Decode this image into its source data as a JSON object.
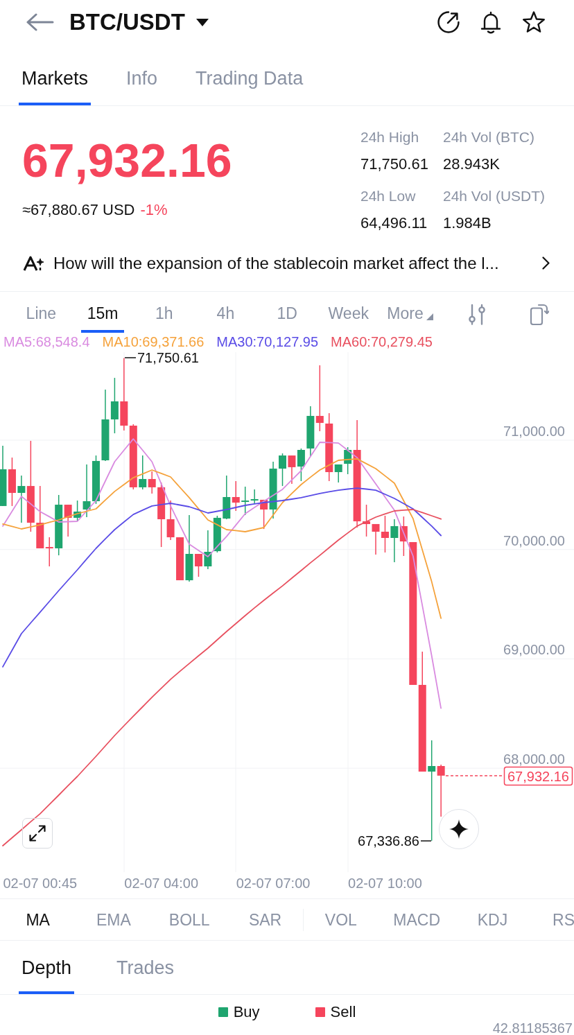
{
  "header": {
    "title": "BTC/USDT"
  },
  "tabs": [
    {
      "label": "Markets",
      "selected": true
    },
    {
      "label": "Info",
      "selected": false
    },
    {
      "label": "Trading Data",
      "selected": false
    }
  ],
  "ticker": {
    "price": "67,932.16",
    "fiat_value": "≈67,880.67 USD",
    "change": "-1%",
    "stats": [
      {
        "label": "24h High",
        "value": "71,750.61"
      },
      {
        "label": "24h Vol (BTC)",
        "value": "28.943K"
      },
      {
        "label": "24h Low",
        "value": "64,496.11"
      },
      {
        "label": "24h Vol (USDT)",
        "value": "1.984B"
      }
    ]
  },
  "news": {
    "headline": "How will the expansion of the stablecoin market affect the l..."
  },
  "intervals": [
    {
      "label": "Line",
      "kind": "option",
      "selected": false
    },
    {
      "label": "15m",
      "kind": "option",
      "selected": true
    },
    {
      "label": "1h",
      "kind": "option",
      "selected": false
    },
    {
      "label": "4h",
      "kind": "option",
      "selected": false
    },
    {
      "label": "1D",
      "kind": "option",
      "selected": false
    },
    {
      "label": "Week",
      "kind": "option",
      "selected": false
    },
    {
      "label": "More",
      "kind": "menu",
      "selected": false
    }
  ],
  "chart": {
    "chart_data": {
      "type": "candlestick",
      "grid": true,
      "categories": [
        null,
        null,
        null,
        null,
        "02-07 00:45",
        null,
        null,
        null,
        null,
        null,
        null,
        null,
        null,
        null,
        null,
        null,
        null,
        "02-07 04:00",
        null,
        null,
        null,
        null,
        null,
        null,
        null,
        null,
        null,
        null,
        null,
        "02-07 07:00",
        null,
        null,
        null,
        null,
        null,
        null,
        null,
        null,
        null,
        null,
        null,
        "02-07 10:00",
        null,
        null,
        null,
        null,
        null,
        null
      ],
      "ylim": [
        67050,
        71805
      ],
      "yticks": [
        {
          "value": 71000,
          "label": "71,000.00"
        },
        {
          "value": 70000,
          "label": "70,000.00"
        },
        {
          "value": 69000,
          "label": "69,000.00"
        },
        {
          "value": 68000,
          "label": "68,000.00"
        }
      ],
      "ohlc": [
        [
          70398,
          70949,
          70398,
          70734
        ],
        [
          70734,
          70841,
          70398,
          70518
        ],
        [
          70518,
          70677,
          70245,
          70581
        ],
        [
          70581,
          70994,
          70163,
          70245
        ],
        [
          70245,
          70581,
          70011,
          70011
        ],
        [
          70023,
          70112,
          69846,
          70011
        ],
        [
          70011,
          70499,
          69947,
          70410
        ],
        [
          70410,
          70410,
          70119,
          70290
        ],
        [
          70290,
          70448,
          70264,
          70347
        ],
        [
          70366,
          70778,
          70296,
          70442
        ],
        [
          70442,
          70860,
          70417,
          70810
        ],
        [
          70816,
          71463,
          70810,
          71190
        ],
        [
          71190,
          71570,
          71063,
          71355
        ],
        [
          71355,
          71751,
          71089,
          71133
        ],
        [
          71133,
          71146,
          70550,
          70569
        ],
        [
          70569,
          70860,
          70550,
          70645
        ],
        [
          70645,
          70715,
          70512,
          70569
        ],
        [
          70569,
          70613,
          70023,
          70277
        ],
        [
          70277,
          70448,
          70087,
          70112
        ],
        [
          70112,
          70112,
          69719,
          69719
        ],
        [
          69719,
          70315,
          69706,
          69960
        ],
        [
          69960,
          69960,
          69751,
          69846
        ],
        [
          69846,
          70176,
          69821,
          69979
        ],
        [
          69985,
          70309,
          69973,
          70290
        ],
        [
          70283,
          70677,
          70277,
          70480
        ],
        [
          70480,
          70626,
          70353,
          70429
        ],
        [
          70436,
          70575,
          70315,
          70448
        ],
        [
          70448,
          70550,
          70417,
          70461
        ],
        [
          70455,
          70455,
          70188,
          70366
        ],
        [
          70366,
          70803,
          70283,
          70740
        ],
        [
          70740,
          70879,
          70581,
          70860
        ],
        [
          70860,
          70860,
          70600,
          70753
        ],
        [
          70759,
          70924,
          70626,
          70911
        ],
        [
          70924,
          71310,
          70854,
          71222
        ],
        [
          71222,
          71685,
          71082,
          71158
        ],
        [
          71152,
          71247,
          70626,
          70708
        ],
        [
          70708,
          70778,
          70613,
          70778
        ],
        [
          70784,
          70936,
          70689,
          70911
        ],
        [
          70911,
          71184,
          70201,
          70258
        ],
        [
          70258,
          70410,
          70119,
          70233
        ],
        [
          70233,
          70233,
          69954,
          70163
        ],
        [
          70163,
          70309,
          69973,
          70106
        ],
        [
          70106,
          70277,
          69884,
          70214
        ],
        [
          70214,
          70302,
          69941,
          70074
        ],
        [
          70068,
          70068,
          68762,
          68762
        ],
        [
          68762,
          69066,
          67969,
          67969
        ],
        [
          67969,
          68255,
          67337,
          68020
        ],
        [
          68020,
          68033,
          67557,
          67932
        ]
      ],
      "series": [
        {
          "name": "MA5:68,548.4",
          "type": "line",
          "color": "#d98be0",
          "values": [
            70214,
            70350,
            70486,
            70417,
            70347,
            70300,
            70252,
            70255,
            70258,
            70353,
            70448,
            70626,
            70803,
            70908,
            71012,
            70908,
            70803,
            70601,
            70398,
            70224,
            70049,
            69992,
            69935,
            70027,
            70119,
            70224,
            70328,
            70385,
            70442,
            70496,
            70550,
            70636,
            70721,
            70851,
            70981,
            70978,
            70974,
            70908,
            70841,
            70721,
            70600,
            70480,
            70359,
            70150,
            69941,
            69485,
            69028,
            68548
          ]
        },
        {
          "name": "MA10:69,371.66",
          "type": "line",
          "color": "#f5a23b",
          "values": [
            70233,
            70211,
            70188,
            70207,
            70226,
            70249,
            70271,
            70300,
            70328,
            70350,
            70372,
            70452,
            70531,
            70594,
            70657,
            70692,
            70727,
            70696,
            70664,
            70569,
            70474,
            70373,
            70271,
            70227,
            70182,
            70173,
            70163,
            70182,
            70201,
            70315,
            70429,
            70512,
            70594,
            70661,
            70727,
            70772,
            70816,
            70823,
            70829,
            70785,
            70740,
            70674,
            70607,
            70445,
            70283,
            69995,
            69706,
            69372
          ]
        },
        {
          "name": "MA30:70,127.95",
          "type": "line",
          "color": "#5a4ce6",
          "values": [
            68927,
            69079,
            69231,
            69329,
            69427,
            69526,
            69624,
            69719,
            69814,
            69913,
            70011,
            70097,
            70182,
            70252,
            70321,
            70360,
            70398,
            70411,
            70423,
            70407,
            70391,
            70363,
            70334,
            70350,
            70366,
            70385,
            70404,
            70417,
            70429,
            70439,
            70448,
            70461,
            70474,
            70493,
            70512,
            70528,
            70543,
            70553,
            70562,
            70553,
            70543,
            70505,
            70467,
            70420,
            70372,
            70293,
            70214,
            70128
          ]
        },
        {
          "name": "MA60:70,279.45",
          "type": "line",
          "color": "#e8505f",
          "values": [
            67291,
            67364,
            67437,
            67510,
            67583,
            67669,
            67754,
            67840,
            67925,
            68017,
            68109,
            68204,
            68299,
            68388,
            68476,
            68562,
            68648,
            68731,
            68813,
            68886,
            68958,
            69028,
            69098,
            69174,
            69250,
            69323,
            69396,
            69466,
            69535,
            69602,
            69668,
            69738,
            69808,
            69878,
            69947,
            70017,
            70087,
            70151,
            70214,
            70255,
            70296,
            70325,
            70353,
            70360,
            70366,
            70338,
            70309,
            70279
          ]
        }
      ]
    },
    "high_label": "71,750.61",
    "low_label": "67,336.86",
    "last_price": "67,932.16"
  },
  "main_indicators": [
    {
      "label": "MA",
      "selected": true
    },
    {
      "label": "EMA",
      "selected": false
    },
    {
      "label": "BOLL",
      "selected": false
    },
    {
      "label": "SAR",
      "selected": false
    }
  ],
  "sub_indicators": [
    {
      "label": "VOL",
      "selected": false
    },
    {
      "label": "MACD",
      "selected": false
    },
    {
      "label": "KDJ",
      "selected": false
    },
    {
      "label": "RS",
      "selected": false
    }
  ],
  "book_tabs": [
    {
      "label": "Depth",
      "selected": true
    },
    {
      "label": "Trades",
      "selected": false
    }
  ],
  "depth": {
    "legend": [
      {
        "label": "Buy",
        "color": "#1fa56f"
      },
      {
        "label": "Sell",
        "color": "#f5455c"
      }
    ],
    "axis_value": "42.81185367"
  }
}
